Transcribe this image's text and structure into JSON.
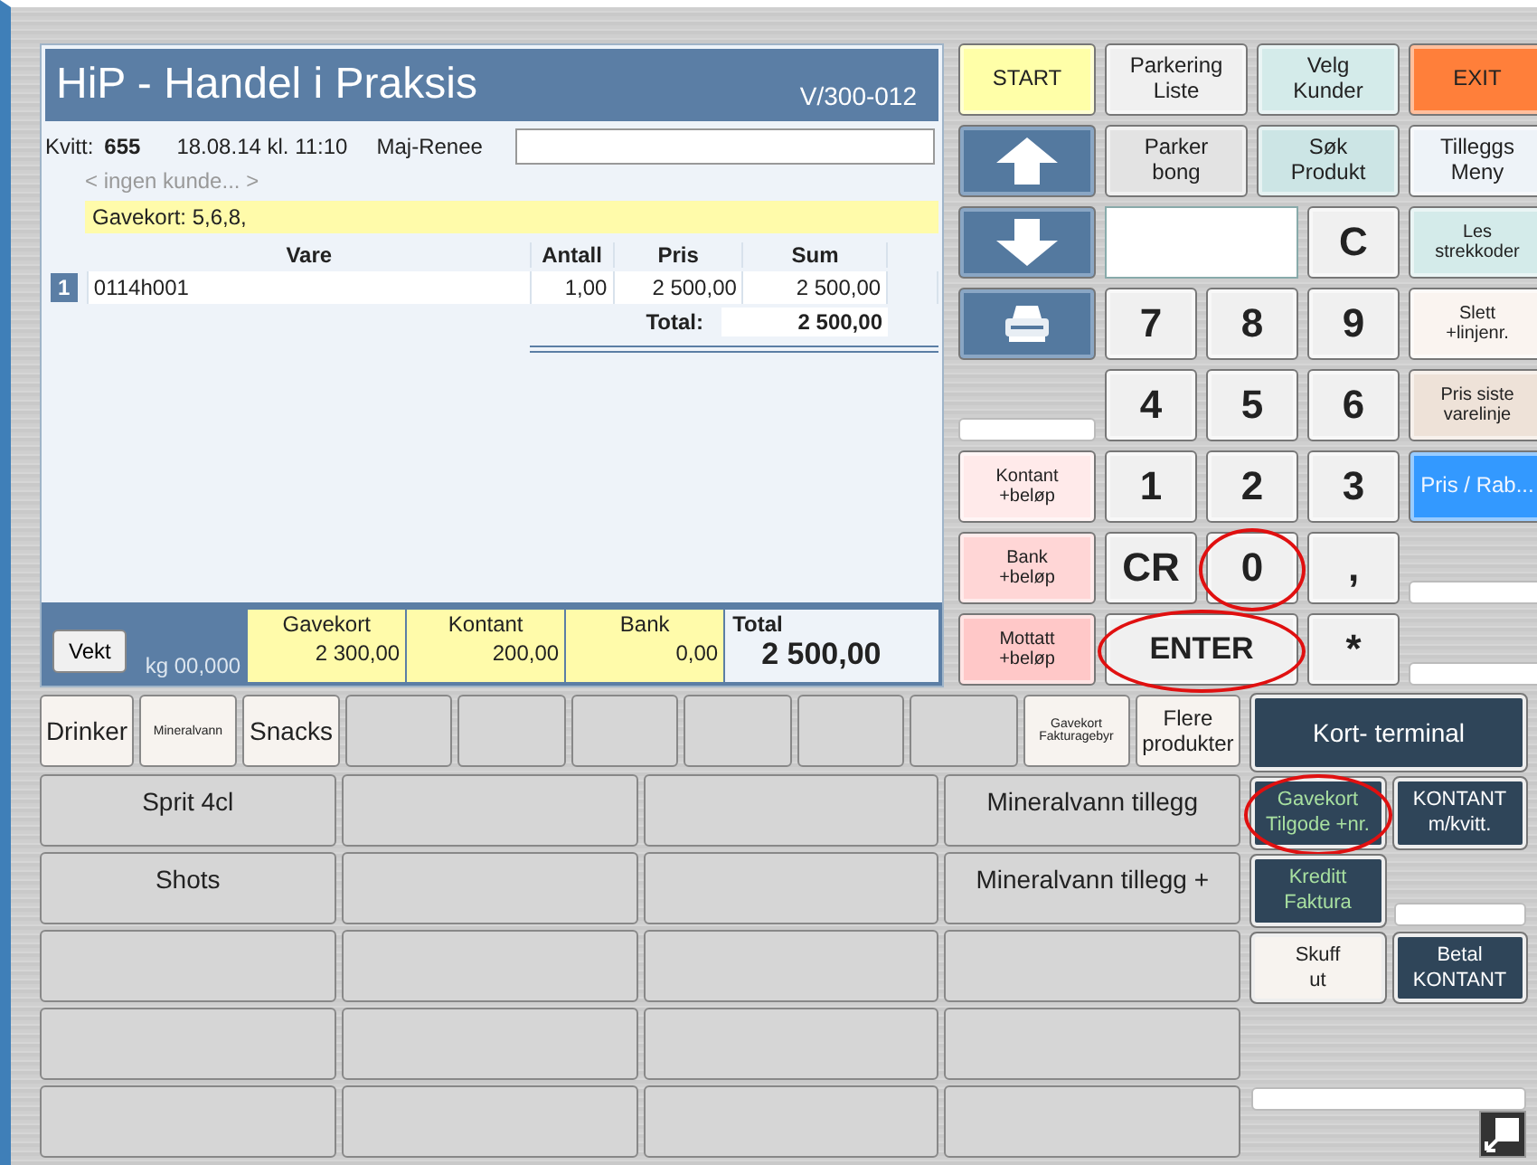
{
  "receipt": {
    "title": "HiP - Handel i Praksis",
    "version": "V/300-012",
    "receipt_label": "Kvitt:",
    "receipt_number": "655",
    "datetime": "18.08.14 kl. 11:10",
    "cashier": "Maj-Renee",
    "customer": "< ingen kunde... >",
    "note": "Gavekort: 5,6,8,",
    "columns": [
      "Vare",
      "Antall",
      "Pris",
      "Sum"
    ],
    "rows": [
      {
        "number": "1",
        "selected": true,
        "cells": [
          "0114h001",
          "1,00",
          "2 500,00",
          "2 500,00"
        ]
      }
    ],
    "total_label": "Total:",
    "total": "2 500,00"
  },
  "footer": {
    "weight_button": "Vekt",
    "weight": "kg 00,000",
    "payments": [
      {
        "label": "Gavekort",
        "amount": "2 300,00"
      },
      {
        "label": "Kontant",
        "amount": "200,00"
      },
      {
        "label": "Bank",
        "amount": "0,00"
      }
    ],
    "total_label": "Total",
    "total": "2 500,00"
  },
  "keypad": [
    {
      "kind": "side",
      "lines": [
        "START"
      ],
      "color": "#ffffa8",
      "circled": false
    },
    {
      "kind": "wide",
      "lines": [
        "Parkering",
        "Liste"
      ],
      "color": "#f0f0f0",
      "circled": false
    },
    {
      "kind": "wide",
      "lines": [
        "Velg",
        "Kunder"
      ],
      "color": "#d4ebea",
      "circled": false
    },
    {
      "kind": "side",
      "lines": [
        "EXIT"
      ],
      "color": "#ff7f3a",
      "circled": false
    },
    {
      "kind": "arrow-up",
      "color": "#54799f",
      "circled": false
    },
    {
      "kind": "wide",
      "lines": [
        "Parker",
        "bong"
      ],
      "color": "#e3e3e3",
      "circled": false
    },
    {
      "kind": "wide",
      "lines": [
        "Søk",
        "Produkt"
      ],
      "color": "#cce5e5",
      "circled": false
    },
    {
      "kind": "side",
      "lines": [
        "Tilleggs",
        "Meny"
      ],
      "color": "#eef3f8",
      "circled": false
    },
    {
      "kind": "arrow-down",
      "color": "#54799f",
      "circled": false
    },
    {
      "kind": "input",
      "circled": false
    },
    {
      "kind": "digit",
      "lines": [
        "C"
      ],
      "color": "#f0f0f0",
      "circled": false
    },
    {
      "kind": "side-small",
      "lines": [
        "Les",
        "strekkoder"
      ],
      "color": "#d4ebea",
      "circled": false
    },
    {
      "kind": "printer",
      "color": "#54799f",
      "circled": false
    },
    {
      "kind": "digit",
      "lines": [
        "7"
      ],
      "color": "#f0f0f0",
      "circled": false
    },
    {
      "kind": "digit",
      "lines": [
        "8"
      ],
      "color": "#f0f0f0",
      "circled": false
    },
    {
      "kind": "digit",
      "lines": [
        "9"
      ],
      "color": "#f0f0f0",
      "circled": false
    },
    {
      "kind": "side-small",
      "lines": [
        "Slett",
        "+linjenr."
      ],
      "color": "#faf4f0",
      "circled": false
    },
    {
      "kind": "blank",
      "circled": false
    },
    {
      "kind": "digit",
      "lines": [
        "4"
      ],
      "color": "#f0f0f0",
      "circled": false
    },
    {
      "kind": "digit",
      "lines": [
        "5"
      ],
      "color": "#f0f0f0",
      "circled": false
    },
    {
      "kind": "digit",
      "lines": [
        "6"
      ],
      "color": "#f0f0f0",
      "circled": false
    },
    {
      "kind": "side-small",
      "lines": [
        "Pris siste",
        "varelinje"
      ],
      "color": "#eee2d8",
      "circled": false
    },
    {
      "kind": "side-small",
      "lines": [
        "Kontant",
        "+beløp"
      ],
      "color": "#ffeaea",
      "circled": false
    },
    {
      "kind": "digit",
      "lines": [
        "1"
      ],
      "color": "#f0f0f0",
      "circled": false
    },
    {
      "kind": "digit",
      "lines": [
        "2"
      ],
      "color": "#f0f0f0",
      "circled": false
    },
    {
      "kind": "digit",
      "lines": [
        "3"
      ],
      "color": "#f0f0f0",
      "circled": false
    },
    {
      "kind": "side-light",
      "lines": [
        "Pris / Rab..."
      ],
      "color": "#3399ff",
      "circled": false
    },
    {
      "kind": "side-small",
      "lines": [
        "Bank",
        "+beløp"
      ],
      "color": "#ffd6d6",
      "circled": false
    },
    {
      "kind": "digit",
      "lines": [
        "CR"
      ],
      "color": "#f0f0f0",
      "circled": false
    },
    {
      "kind": "digit",
      "lines": [
        "0"
      ],
      "color": "#f0f0f0",
      "circled": true
    },
    {
      "kind": "digit",
      "lines": [
        ","
      ],
      "color": "#f0f0f0",
      "circled": false
    },
    {
      "kind": "blank",
      "circled": false
    },
    {
      "kind": "side-small",
      "lines": [
        "Mottatt",
        "+beløp"
      ],
      "color": "#ffc8c8",
      "circled": false
    },
    {
      "kind": "double",
      "lines": [
        "ENTER"
      ],
      "color": "#f0f0f0",
      "circled": true
    },
    {
      "kind": "digit",
      "lines": [
        "*"
      ],
      "color": "#f0f0f0",
      "circled": false
    },
    {
      "kind": "blank",
      "circled": false
    }
  ],
  "categories": [
    {
      "kind": "category",
      "label": "Drinker"
    },
    {
      "kind": "small-category",
      "label": "Mineralvann"
    },
    {
      "kind": "category",
      "label": "Snacks"
    },
    {
      "kind": "empty"
    },
    {
      "kind": "empty"
    },
    {
      "kind": "empty"
    },
    {
      "kind": "empty"
    },
    {
      "kind": "empty"
    },
    {
      "kind": "empty"
    },
    {
      "kind": "small-category",
      "label": "Gavekort Fakturagebyr"
    },
    {
      "kind": "category",
      "label": "Flere produkter"
    }
  ],
  "products": [
    {
      "kind": "product",
      "label": "Sprit 4cl"
    },
    {
      "kind": "empty"
    },
    {
      "kind": "empty"
    },
    {
      "kind": "product",
      "label": "Mineralvann tillegg"
    },
    {
      "kind": "product",
      "label": "Shots"
    },
    {
      "kind": "empty"
    },
    {
      "kind": "empty"
    },
    {
      "kind": "product",
      "label": "Mineralvann tillegg +"
    },
    {
      "kind": "empty"
    },
    {
      "kind": "empty"
    },
    {
      "kind": "empty"
    },
    {
      "kind": "empty"
    },
    {
      "kind": "empty"
    },
    {
      "kind": "empty"
    },
    {
      "kind": "empty"
    },
    {
      "kind": "empty"
    },
    {
      "kind": "empty"
    },
    {
      "kind": "empty"
    },
    {
      "kind": "empty"
    },
    {
      "kind": "empty"
    }
  ],
  "payment_keys": [
    {
      "kind": "wide-dark",
      "lines": [
        "Kort- terminal"
      ],
      "color": "#2f4559",
      "circled": false
    },
    {
      "kind": "dark-accent",
      "lines": [
        "Gavekort",
        "Tilgode +nr."
      ],
      "color": "#2f4559",
      "circled": true
    },
    {
      "kind": "dark",
      "lines": [
        "KONTANT",
        "m/kvitt."
      ],
      "color": "#2f4559",
      "circled": false
    },
    {
      "kind": "dark-accent",
      "lines": [
        "Kreditt",
        "Faktura"
      ],
      "color": "#2f4559",
      "circled": false
    },
    {
      "kind": "blank",
      "circled": false
    },
    {
      "kind": "light",
      "lines": [
        "Skuff",
        "ut"
      ],
      "color": "#f7f3ef",
      "circled": false
    },
    {
      "kind": "dark",
      "lines": [
        "Betal",
        "KONTANT"
      ],
      "color": "#2f4559",
      "circled": false
    },
    {
      "kind": "empty",
      "circled": false
    },
    {
      "kind": "empty",
      "circled": false
    },
    {
      "kind": "wide-blank",
      "circled": false
    }
  ]
}
